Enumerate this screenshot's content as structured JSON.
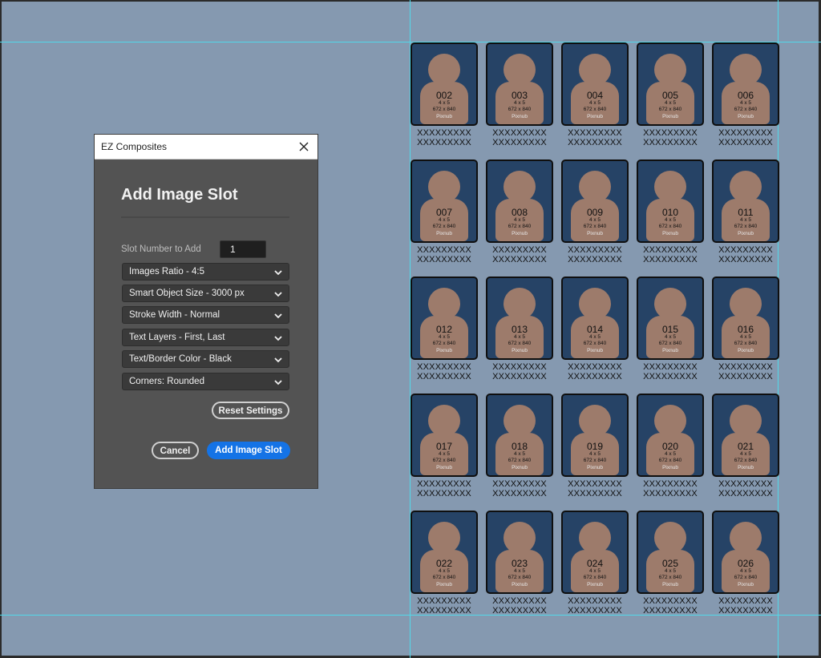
{
  "dialog": {
    "window_title": "EZ Composites",
    "heading": "Add Image Slot",
    "slot_number_label": "Slot Number to Add",
    "slot_number_value": "1",
    "dropdowns": [
      {
        "label": "Images Ratio - 4:5"
      },
      {
        "label": "Smart Object Size - 3000 px"
      },
      {
        "label": "Stroke Width - Normal"
      },
      {
        "label": "Text Layers - First, Last"
      },
      {
        "label": "Text/Border Color - Black"
      },
      {
        "label": "Corners: Rounded"
      }
    ],
    "reset_button": "Reset Settings",
    "cancel_button": "Cancel",
    "add_button": "Add Image Slot",
    "accent_color": "#1473e6"
  },
  "slots": {
    "ratio": "4 x 5",
    "size": "672 x 840",
    "brand": "Pixnub",
    "first_name": "XXXXXXXXX",
    "last_name": "XXXXXXXXX",
    "numbers": [
      "002",
      "003",
      "004",
      "005",
      "006",
      "007",
      "008",
      "009",
      "010",
      "011",
      "012",
      "013",
      "014",
      "015",
      "016",
      "017",
      "018",
      "019",
      "020",
      "021",
      "022",
      "023",
      "024",
      "025",
      "026"
    ]
  },
  "colors": {
    "canvas_bg": "#8599b0",
    "slot_bg": "#264366",
    "silhouette": "#9d7b6b",
    "guide": "#52d8ea"
  }
}
